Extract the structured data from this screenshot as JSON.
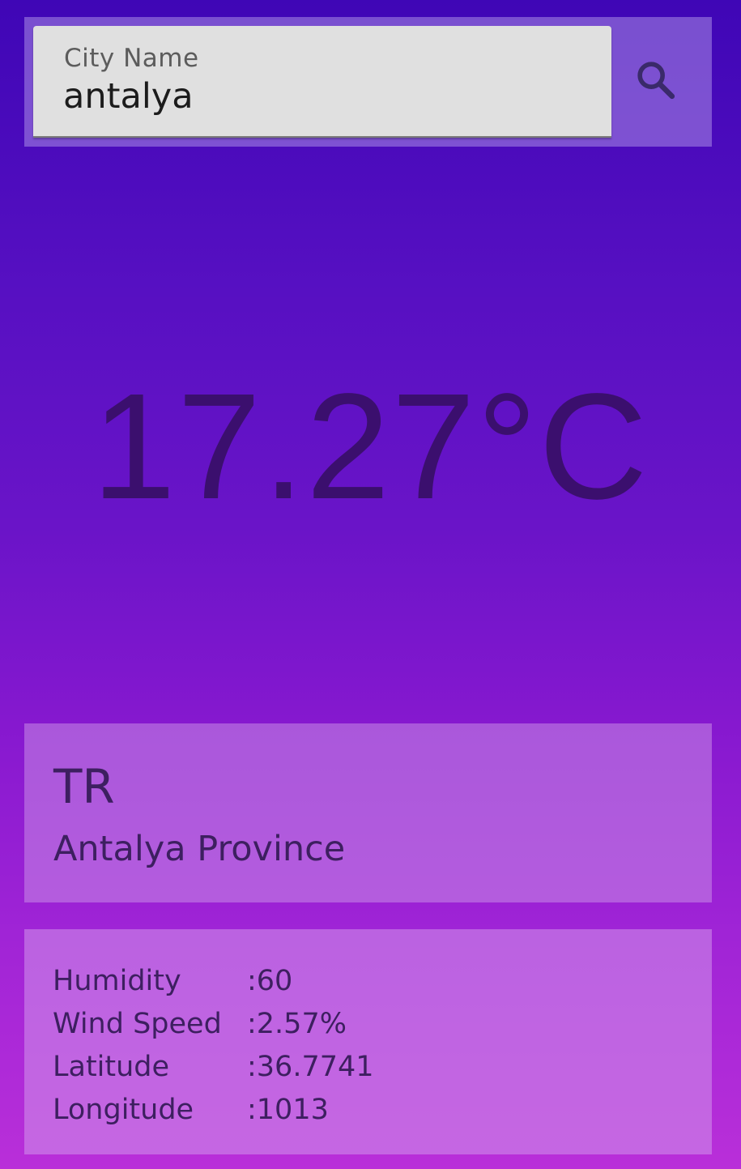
{
  "search": {
    "label": "City Name",
    "value": "antalya",
    "icon": "search-icon"
  },
  "weather": {
    "temperature": "17.27°C"
  },
  "location": {
    "country": "TR",
    "region": "Antalya Province"
  },
  "details": [
    {
      "label": "Humidity",
      "value": ":60"
    },
    {
      "label": "Wind Speed",
      "value": ":2.57%"
    },
    {
      "label": "Latitude",
      "value": ":36.7741"
    },
    {
      "label": "Longitude",
      "value": ":1013"
    }
  ],
  "colors": {
    "text_dark": "#3d1f60",
    "temperature_text": "#3b0f6e",
    "gradient_top": "#3f06b6",
    "gradient_bottom": "#b92fd9"
  }
}
